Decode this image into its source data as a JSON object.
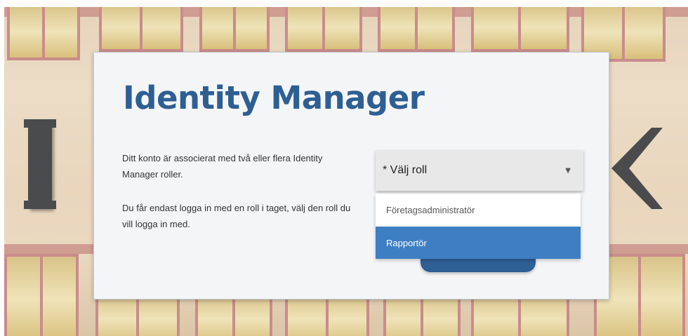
{
  "card": {
    "title": "Identity Manager",
    "description_1": "Ditt konto är associerat med två eller flera Identity Manager roller.",
    "description_2": "Du får endast logga in med en roll i taget, välj den roll du vill logga in med."
  },
  "role_select": {
    "value": "* Välj roll",
    "caret_icon": "triangle-down",
    "options": [
      {
        "label": "Företagsadministratör",
        "highlighted": false
      },
      {
        "label": "Rapportör",
        "highlighted": true
      }
    ]
  },
  "colors": {
    "title": "#2d5f92",
    "highlight": "#3e7fc3",
    "button": "#2e5f95"
  }
}
